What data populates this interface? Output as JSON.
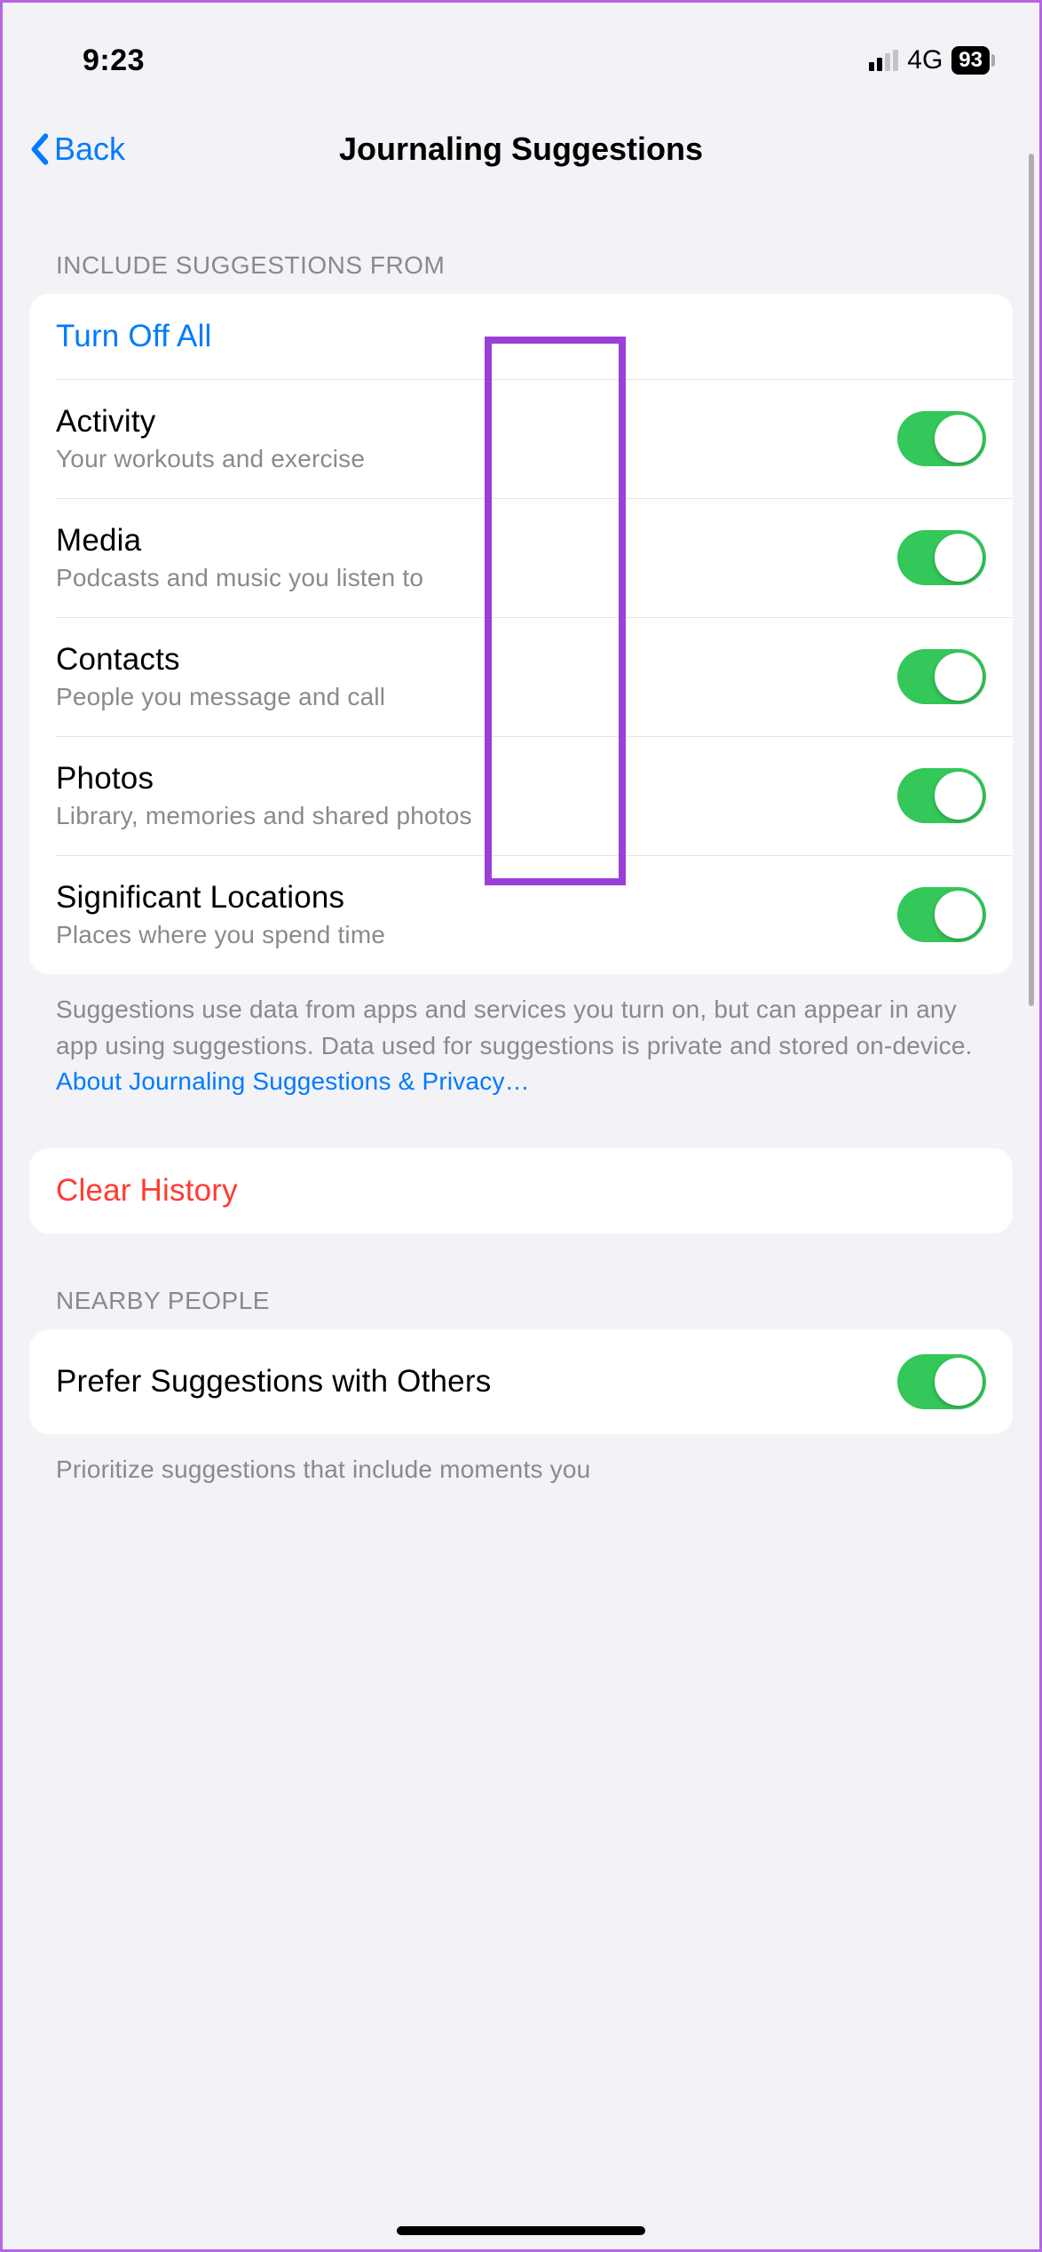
{
  "status": {
    "time": "9:23",
    "network": "4G",
    "battery": "93"
  },
  "nav": {
    "back_label": "Back",
    "title": "Journaling Suggestions"
  },
  "section1": {
    "header": "INCLUDE SUGGESTIONS FROM",
    "turn_off_all": "Turn Off All",
    "items": [
      {
        "title": "Activity",
        "subtitle": "Your workouts and exercise",
        "on": true
      },
      {
        "title": "Media",
        "subtitle": "Podcasts and music you listen to",
        "on": true
      },
      {
        "title": "Contacts",
        "subtitle": "People you message and call",
        "on": true
      },
      {
        "title": "Photos",
        "subtitle": "Library, memories and shared photos",
        "on": true
      },
      {
        "title": "Significant Locations",
        "subtitle": "Places where you spend time",
        "on": true
      }
    ],
    "footer": "Suggestions use data from apps and services you turn on, but can appear in any app using suggestions. Data used for suggestions is private and stored on-device. ",
    "footer_link": "About Journaling Suggestions & Privacy…"
  },
  "clear_history": "Clear History",
  "section2": {
    "header": "NEARBY PEOPLE",
    "item": {
      "title": "Prefer Suggestions with Others",
      "on": true
    },
    "footer": "Prioritize suggestions that include moments you"
  }
}
